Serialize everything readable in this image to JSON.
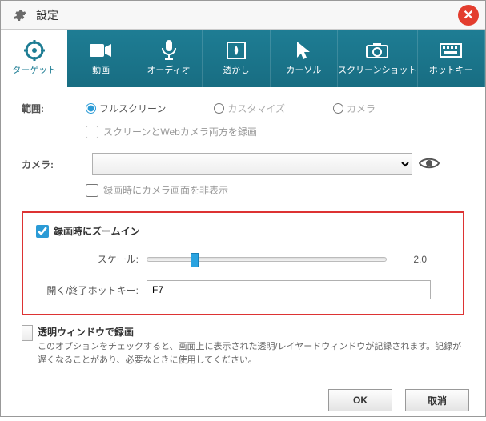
{
  "window": {
    "title": "設定"
  },
  "tabs": [
    {
      "label": "ターゲット"
    },
    {
      "label": "動画"
    },
    {
      "label": "オーディオ"
    },
    {
      "label": "透かし"
    },
    {
      "label": "カーソル"
    },
    {
      "label": "スクリーンショット"
    },
    {
      "label": "ホットキー"
    }
  ],
  "range": {
    "label": "範囲:",
    "opt_fullscreen": "フルスクリーン",
    "opt_customize": "カスタマイズ",
    "opt_camera": "カメラ",
    "cb_both": "スクリーンとWebカメラ両方を録画"
  },
  "camera": {
    "label": "カメラ:",
    "cb_hide": "録画時にカメラ画面を非表示"
  },
  "zoom": {
    "title": "録画時にズームイン",
    "scale_label": "スケール:",
    "scale_value": "2.0",
    "hotkey_label": "開く/終了ホットキー:",
    "hotkey_value": "F7"
  },
  "transparent": {
    "title": "透明ウィンドウで録画",
    "desc": "このオプションをチェックすると、画面上に表示された透明/レイヤードウィンドウが記録されます。記録が遅くなることがあり、必要なときに使用してください。"
  },
  "buttons": {
    "ok": "OK",
    "cancel": "取消"
  }
}
